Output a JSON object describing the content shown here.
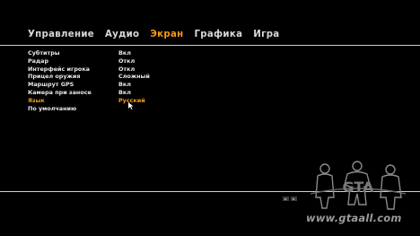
{
  "tabs": [
    {
      "label": "Управление",
      "active": false
    },
    {
      "label": "Аудио",
      "active": false
    },
    {
      "label": "Экран",
      "active": true
    },
    {
      "label": "Графика",
      "active": false
    },
    {
      "label": "Игра",
      "active": false
    }
  ],
  "settings": [
    {
      "label": "Субтитры",
      "value": "Вкл"
    },
    {
      "label": "Радар",
      "value": "Откл"
    },
    {
      "label": "Интерфейс игрока",
      "value": "Откл"
    },
    {
      "label": "Прицел оружия",
      "value": "Сложный"
    },
    {
      "label": "Маршрут GPS",
      "value": "Вкл"
    },
    {
      "label": "Камера при заносе",
      "value": "Вкл"
    },
    {
      "label": "Язык",
      "value": "Русский",
      "selected": true
    },
    {
      "label": "По умолчанию",
      "value": ""
    }
  ],
  "watermark": "www.gtaall.com",
  "logo_text": "GTA",
  "colors": {
    "accent": "#f39a1c",
    "text": "#e8e8e8",
    "background": "#000000"
  },
  "icons": [
    "cursor-arrow-icon",
    "prev-icon",
    "next-icon",
    "gta-characters-logo"
  ]
}
